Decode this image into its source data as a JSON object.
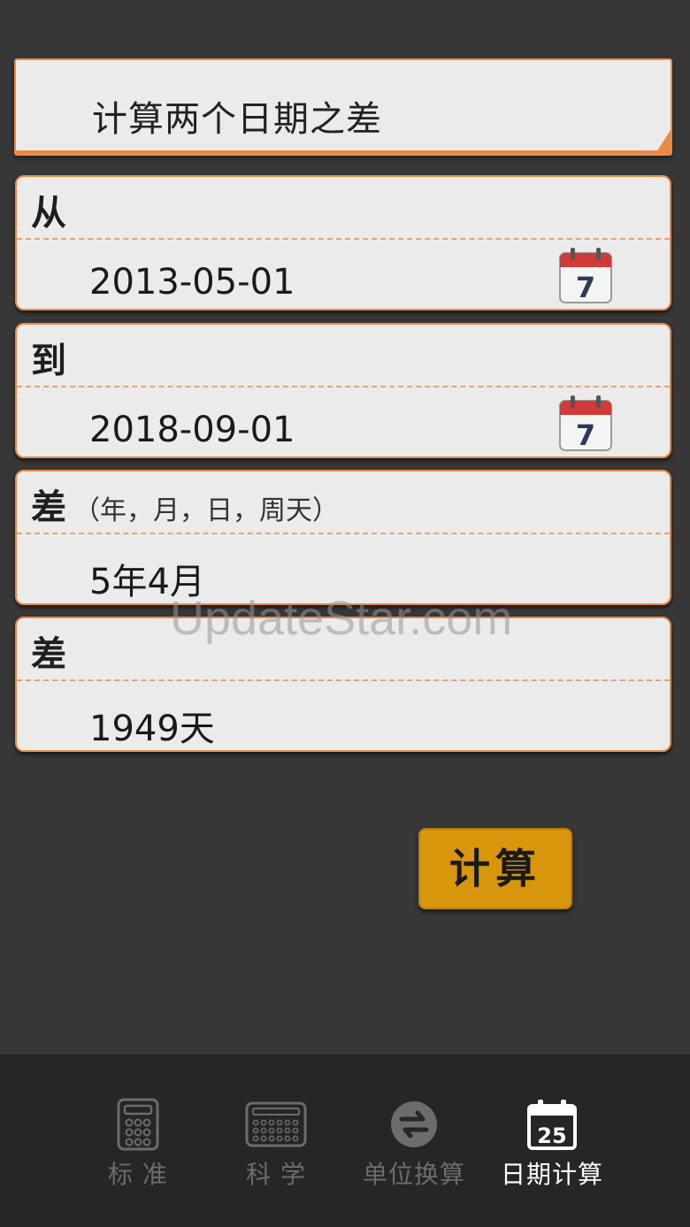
{
  "header": {
    "title": "计算两个日期之差"
  },
  "from": {
    "label": "从",
    "date": "2013-05-01",
    "calendar_icon_day": "7"
  },
  "to": {
    "label": "到",
    "date": "2018-09-01",
    "calendar_icon_day": "7"
  },
  "diff_ymd": {
    "label": "差",
    "sublabel": "（年，月，日，周天）",
    "value": "5年4月"
  },
  "diff_days": {
    "label": "差",
    "value": "1949天"
  },
  "calculate_button": {
    "label": "计算"
  },
  "watermark": "UpdateStar.com",
  "tabs": [
    {
      "label": "标 准",
      "icon": "calculator-icon",
      "active": false
    },
    {
      "label": "科 学",
      "icon": "scientific-keypad-icon",
      "active": false
    },
    {
      "label": "单位换算",
      "icon": "swap-arrows-icon",
      "active": false
    },
    {
      "label": "日期计算",
      "icon": "calendar-icon",
      "icon_text": "25",
      "active": true
    }
  ],
  "colors": {
    "background": "#373737",
    "card": "#ebebeb",
    "accent_border": "#e98b45",
    "button": "#d7960c",
    "tabbar": "#262626"
  }
}
